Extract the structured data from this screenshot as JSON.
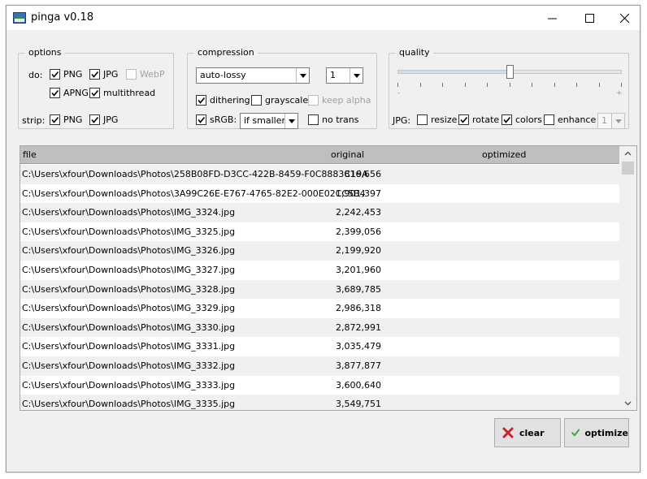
{
  "window": {
    "title": "pinga v0.18"
  },
  "options": {
    "legend": "options",
    "do_label": "do:",
    "strip_label": "strip:",
    "do_png": {
      "label": "PNG",
      "checked": true
    },
    "do_jpg": {
      "label": "JPG",
      "checked": true
    },
    "do_webp": {
      "label": "WebP",
      "checked": false,
      "disabled": true
    },
    "do_apng": {
      "label": "APNG",
      "checked": true
    },
    "multithread": {
      "label": "multithread",
      "checked": true
    },
    "strip_png": {
      "label": "PNG",
      "checked": true
    },
    "strip_jpg": {
      "label": "JPG",
      "checked": true
    }
  },
  "compression": {
    "legend": "compression",
    "mode": "auto-lossy",
    "level": "1",
    "dithering": {
      "label": "dithering",
      "checked": true
    },
    "grayscale": {
      "label": "grayscale",
      "checked": false
    },
    "keep_alpha": {
      "label": "keep alpha",
      "checked": false,
      "disabled": true
    },
    "srgb": {
      "label": "sRGB:",
      "checked": true
    },
    "srgb_mode": "if smaller",
    "no_trans": {
      "label": "no trans",
      "checked": false
    }
  },
  "quality": {
    "legend": "quality",
    "slider_value": 0.5,
    "minus": "-",
    "plus": "+",
    "jpg_label": "JPG:",
    "resize": {
      "label": "resize",
      "checked": false
    },
    "rotate": {
      "label": "rotate",
      "checked": true
    },
    "colors": {
      "label": "colors",
      "checked": true
    },
    "enhance": {
      "label": "enhance",
      "checked": false
    },
    "enhance_level": "1"
  },
  "table": {
    "headers": {
      "file": "file",
      "original": "original",
      "optimized": "optimized"
    },
    "rows": [
      {
        "file": "C:\\Users\\xfour\\Downloads\\Photos\\258B08FD-D3CC-422B-8459-F0C8883C19A",
        "original": "816,656",
        "optimized": ""
      },
      {
        "file": "C:\\Users\\xfour\\Downloads\\Photos\\3A99C26E-E767-4765-82E2-000E02CC5B4",
        "original": "1,901,397",
        "optimized": ""
      },
      {
        "file": "C:\\Users\\xfour\\Downloads\\Photos\\IMG_3324.jpg",
        "original": "2,242,453",
        "optimized": ""
      },
      {
        "file": "C:\\Users\\xfour\\Downloads\\Photos\\IMG_3325.jpg",
        "original": "2,399,056",
        "optimized": ""
      },
      {
        "file": "C:\\Users\\xfour\\Downloads\\Photos\\IMG_3326.jpg",
        "original": "2,199,920",
        "optimized": ""
      },
      {
        "file": "C:\\Users\\xfour\\Downloads\\Photos\\IMG_3327.jpg",
        "original": "3,201,960",
        "optimized": ""
      },
      {
        "file": "C:\\Users\\xfour\\Downloads\\Photos\\IMG_3328.jpg",
        "original": "3,689,785",
        "optimized": ""
      },
      {
        "file": "C:\\Users\\xfour\\Downloads\\Photos\\IMG_3329.jpg",
        "original": "2,986,318",
        "optimized": ""
      },
      {
        "file": "C:\\Users\\xfour\\Downloads\\Photos\\IMG_3330.jpg",
        "original": "2,872,991",
        "optimized": ""
      },
      {
        "file": "C:\\Users\\xfour\\Downloads\\Photos\\IMG_3331.jpg",
        "original": "3,035,479",
        "optimized": ""
      },
      {
        "file": "C:\\Users\\xfour\\Downloads\\Photos\\IMG_3332.jpg",
        "original": "3,877,877",
        "optimized": ""
      },
      {
        "file": "C:\\Users\\xfour\\Downloads\\Photos\\IMG_3333.jpg",
        "original": "3,600,640",
        "optimized": ""
      },
      {
        "file": "C:\\Users\\xfour\\Downloads\\Photos\\IMG_3335.jpg",
        "original": "3,549,751",
        "optimized": ""
      }
    ]
  },
  "actions": {
    "clear_label": "clear",
    "clear_icon": "red-x-icon",
    "optimize_label": "optimize",
    "optimize_icon": "green-check-icon"
  },
  "colors": {
    "header_bg": "#bfbfbf",
    "clear_icon": "#c8232c",
    "optimize_icon": "#3aa543"
  }
}
